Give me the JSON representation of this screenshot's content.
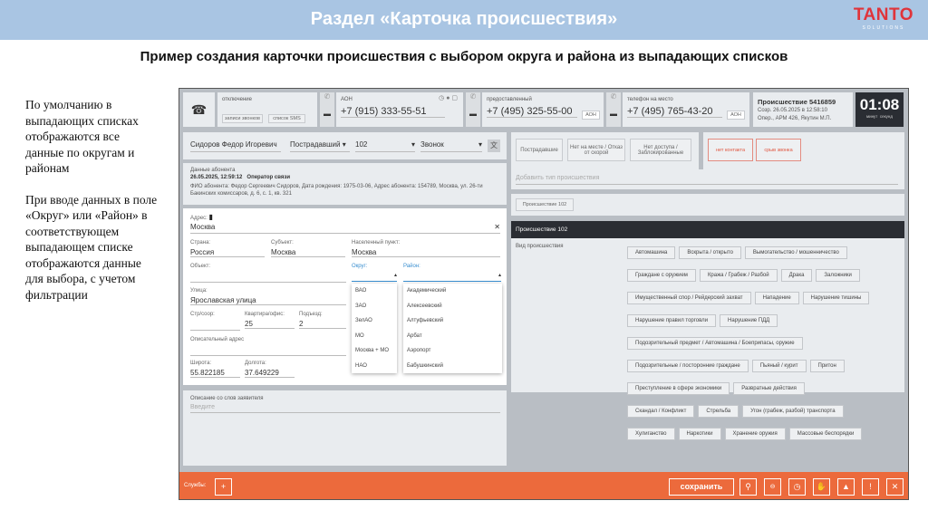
{
  "slide": {
    "title": "Раздел «Карточка происшествия»",
    "subtitle": "Пример создания карточки происшествия с выбором округа и района из выпадающих списков",
    "logo": "TANTO",
    "logo_sub": "SOLUTIONS",
    "para1": "По умолчанию в выпадающих списках отображаются все данные по округам и районам",
    "para2": "При вводе данных в поле «Округ» или «Район» в соответствующем выпадающем списке отображаются данные для выбора, с учетом фильтрации"
  },
  "call": {
    "status": "отключение",
    "rec_btn": "записи звонков",
    "sms_btn": "список SMS"
  },
  "aon": {
    "label": "АОН",
    "number": "+7 (915) 333-55-51"
  },
  "provided": {
    "label": "предоставленный",
    "number": "+7 (495) 325-55-00",
    "aon": "АОН"
  },
  "onsite": {
    "label": "телефон на место",
    "number": "+7 (495) 765-43-20",
    "aon": "АОН"
  },
  "incident": {
    "title": "Происшествие 5416859",
    "created": "Созр. 26.05.2025 в 12:58:10",
    "operator": "Опер., АРМ 426, Якутин М.П."
  },
  "timer": {
    "value": "01:08",
    "min": "минут",
    "sec": "секунд"
  },
  "caller": {
    "name": "Сидоров Федор Игоревич",
    "role": "Пострадавший",
    "service": "102",
    "channel": "Звонок"
  },
  "quick": {
    "b1": "Пострадавшие",
    "b2": "Нет на месте / Отказ от скорой",
    "b3": "Нет доступа / Заблокированные",
    "c1": "нет контакта",
    "c2": "срыв звонка"
  },
  "subscriber": {
    "title": "Данные абонента",
    "date": "26.05.2025, 12:59:12",
    "operator": "Оператор связи",
    "info": "ФИО абонента: Федор Сергеевич Сидоров, Дата рождения: 1975-03-06, Адрес абонента: 154789, Москва, ул. 26-ти Бакинских комиссаров, д. 6, с. 1, кв. 321"
  },
  "add_type_placeholder": "Добавить тип происшествия",
  "type_btn": "Происшествие 102",
  "address": {
    "label": "Адрес:",
    "value": "Москва",
    "country_l": "Страна:",
    "country": "Россия",
    "subject_l": "Субъект:",
    "subject": "Москва",
    "city_l": "Населенный пункт:",
    "city": "Москва",
    "object_l": "Объект:",
    "okrug_l": "Округ:",
    "rayon_l": "Район:",
    "street_l": "Улица:",
    "street": "Ярославская улица",
    "bld_l": "Стр/соор:",
    "apt_l": "Квартира/офис:",
    "apt": "25",
    "ent_l": "Подъезд:",
    "ent": "2",
    "desc_l": "Описательный адрес",
    "lat_l": "Широта:",
    "lat": "55.822185",
    "lon_l": "Долгота:",
    "lon": "37.649229"
  },
  "okrug_options": [
    "ВАО",
    "ЗАО",
    "ЗелАО",
    "МО",
    "Москва + МО",
    "НАО"
  ],
  "rayon_options": [
    "Академический",
    "Алексеевский",
    "Алтуфьевский",
    "Арбат",
    "Аэропорт",
    "Бабушкинский"
  ],
  "inc102": {
    "header": "Происшествие 102",
    "kind_label": "Вид происшествия",
    "tags": [
      [
        "Автомашина",
        "Вскрыта / открыто",
        "Вымогательство / мошенничество"
      ],
      [
        "Граждане с оружием",
        "Кража / Грабеж / Разбой",
        "Драка",
        "Заложники"
      ],
      [
        "Имущественный спор / Рейдерский захват",
        "Нападение",
        "Нарушение тишины"
      ],
      [
        "Нарушение правил торговли",
        "Нарушение ПДД"
      ],
      [
        "Подозрительный предмет / Автомашина / Боеприпасы, оружие"
      ],
      [
        "Подозрительные / посторонние граждане",
        "Пьяный / курит",
        "Притон"
      ],
      [
        "Преступление в сфере экономики",
        "Развратные действия"
      ],
      [
        "Скандал / Конфликт",
        "Стрельба",
        "Угон (грабеж, разбой) транспорта"
      ],
      [
        "Хулиганство",
        "Наркотики",
        "Хранение оружия",
        "Массовые беспорядки"
      ]
    ]
  },
  "statement": {
    "label": "Описание со слов заявителя",
    "placeholder": "Введите"
  },
  "footer": {
    "services": "Службы:",
    "save": "сохранить"
  },
  "colors": {
    "header": "#a9c5e3",
    "footer": "#ec6a3c",
    "accent_red": "#e0343a"
  }
}
